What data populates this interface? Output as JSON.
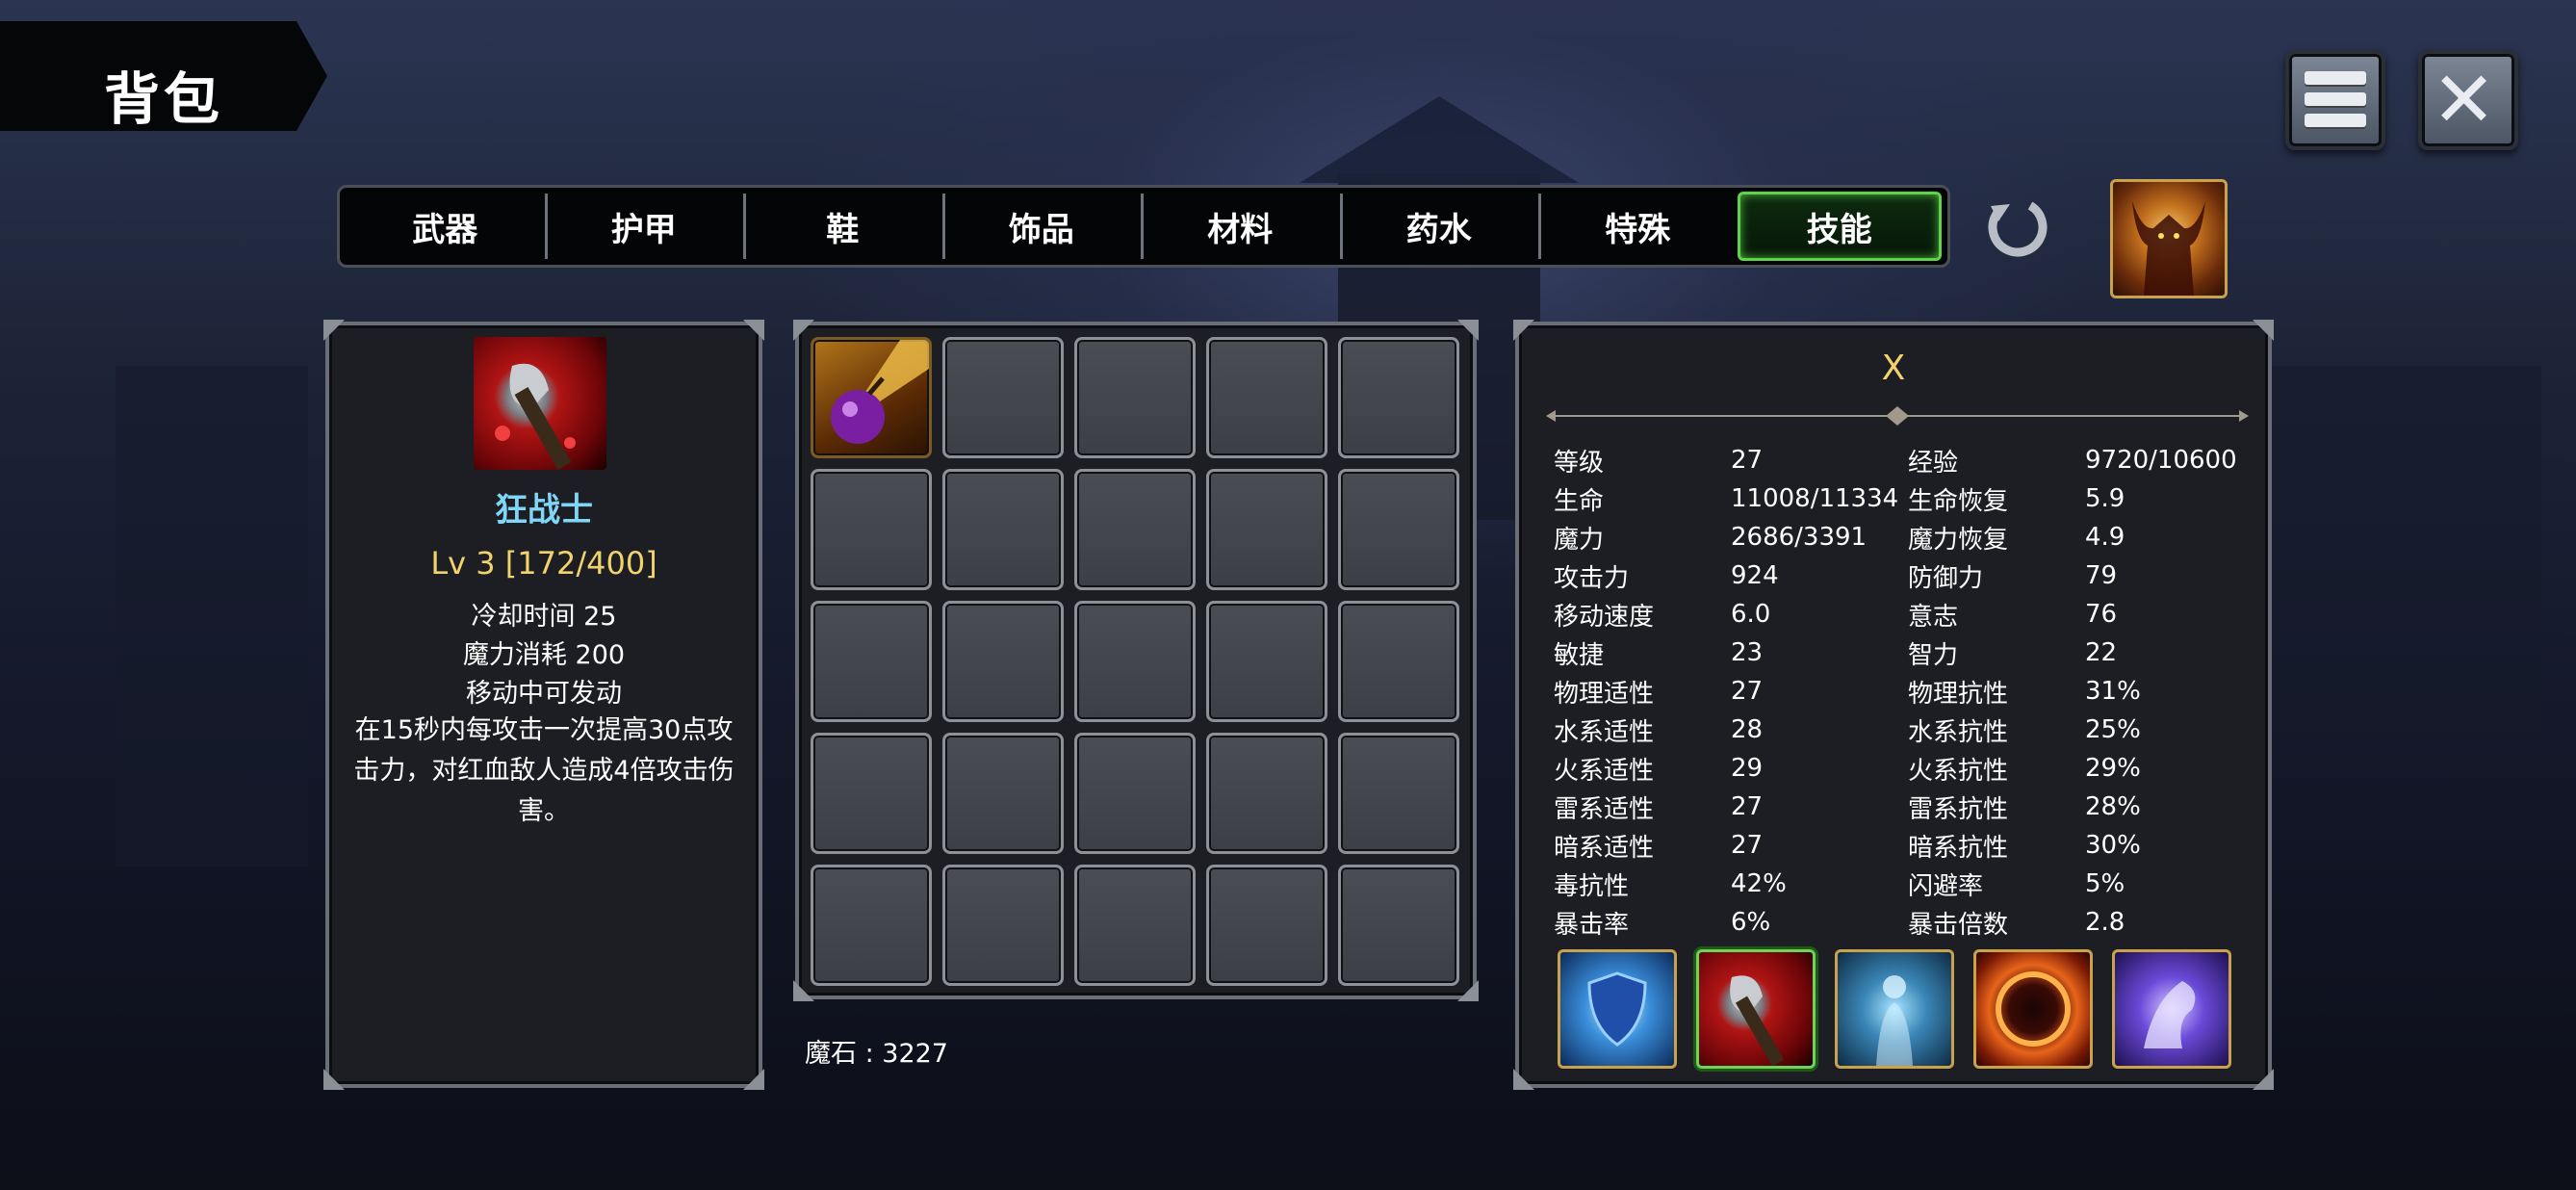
{
  "header": {
    "title": "背包"
  },
  "tabs": [
    {
      "label": "武器",
      "active": false
    },
    {
      "label": "护甲",
      "active": false
    },
    {
      "label": "鞋",
      "active": false
    },
    {
      "label": "饰品",
      "active": false
    },
    {
      "label": "材料",
      "active": false
    },
    {
      "label": "药水",
      "active": false
    },
    {
      "label": "特殊",
      "active": false
    },
    {
      "label": "技能",
      "active": true
    }
  ],
  "icons": {
    "menu": "menu-icon",
    "close": "close-icon",
    "refresh": "refresh-icon",
    "portrait": "demon-portrait-icon"
  },
  "skill_detail": {
    "name": "狂战士",
    "level": "Lv 3 [172/400]",
    "cooldown": "冷却时间 25",
    "mana_cost": "魔力消耗 200",
    "castable_moving": "移动中可发动",
    "description": "在15秒内每攻击一次提高30点攻击力，对红血敌人造成4倍攻击伤害。"
  },
  "inventory": {
    "slots_total": 25,
    "filled_slots": [
      {
        "index": 0,
        "icon": "purple-bomb-icon"
      }
    ],
    "currency": "魔石 : 3227"
  },
  "character": {
    "name": "X",
    "stats": [
      [
        "等级",
        "27",
        "经验",
        "9720/10600"
      ],
      [
        "生命",
        "11008/11334",
        "生命恢复",
        "5.9"
      ],
      [
        "魔力",
        "2686/3391",
        "魔力恢复",
        "4.9"
      ],
      [
        "攻击力",
        "924",
        "防御力",
        "79"
      ],
      [
        "移动速度",
        "6.0",
        "意志",
        "76"
      ],
      [
        "敏捷",
        "23",
        "智力",
        "22"
      ],
      [
        "物理适性",
        "27",
        "物理抗性",
        "31%"
      ],
      [
        "水系适性",
        "28",
        "水系抗性",
        "25%"
      ],
      [
        "火系适性",
        "29",
        "火系抗性",
        "29%"
      ],
      [
        "雷系适性",
        "27",
        "雷系抗性",
        "28%"
      ],
      [
        "暗系适性",
        "27",
        "暗系抗性",
        "30%"
      ],
      [
        "毒抗性",
        "42%",
        "闪避率",
        "5%"
      ],
      [
        "暴击率",
        "6%",
        "暴击倍数",
        "2.8"
      ]
    ],
    "skills": [
      {
        "icon": "blue-shield-icon",
        "selected": false
      },
      {
        "icon": "berserker-axe-icon",
        "selected": true
      },
      {
        "icon": "spirit-aura-icon",
        "selected": false
      },
      {
        "icon": "fire-ring-icon",
        "selected": false
      },
      {
        "icon": "ghost-dragon-icon",
        "selected": false
      }
    ]
  },
  "colors": {
    "accent_gold": "#f2d36b",
    "skill_name": "#7fd6f6",
    "active_tab_border": "#5fd34c",
    "slot_border": "#8d9097"
  }
}
